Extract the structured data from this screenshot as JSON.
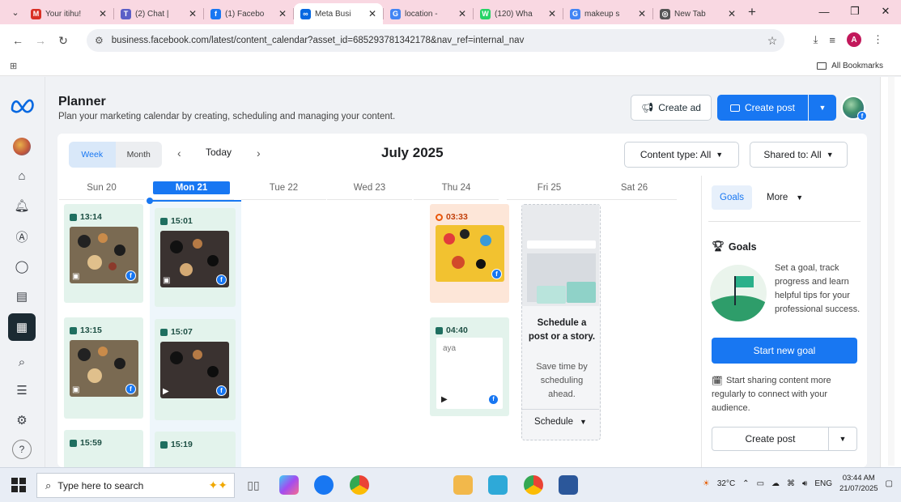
{
  "browser": {
    "tabs": [
      {
        "title": "Your itihu!",
        "icon": "gmail-icon",
        "color": "#d93025",
        "glyph": "M"
      },
      {
        "title": "(2) Chat |",
        "icon": "teams-icon",
        "color": "#5b5fc7",
        "glyph": "T"
      },
      {
        "title": "(1) Facebo",
        "icon": "facebook-icon",
        "color": "#1877f2",
        "glyph": "f"
      },
      {
        "title": "Meta Busi",
        "icon": "meta-icon",
        "color": "#0668e1",
        "glyph": "∞",
        "active": true
      },
      {
        "title": "location -",
        "icon": "google-icon",
        "color": "#4285f4",
        "glyph": "G"
      },
      {
        "title": "(120) Wha",
        "icon": "whatsapp-icon",
        "color": "#25d366",
        "glyph": "W"
      },
      {
        "title": "makeup s",
        "icon": "google-icon",
        "color": "#4285f4",
        "glyph": "G"
      },
      {
        "title": "New Tab",
        "icon": "chrome-icon",
        "color": "#555555",
        "glyph": "◎"
      }
    ],
    "url": "business.facebook.com/latest/content_calendar?asset_id=685293781342178&nav_ref=internal_nav",
    "profile_initial": "A",
    "all_bookmarks": "All Bookmarks"
  },
  "page": {
    "title": "Planner",
    "subtitle": "Plan your marketing calendar by creating, scheduling and managing your content.",
    "create_ad": "Create ad",
    "create_post": "Create post"
  },
  "calendar": {
    "view_week": "Week",
    "view_month": "Month",
    "today": "Today",
    "month_label": "July 2025",
    "content_type": "Content type: All",
    "shared_to": "Shared to: All",
    "days": [
      "Sun 20",
      "Mon 21",
      "Tue 22",
      "Wed 23",
      "Thu 24",
      "Fri 25",
      "Sat 26"
    ],
    "posts": {
      "sun": [
        "13:14",
        "13:15",
        "15:59"
      ],
      "mon": [
        "15:01",
        "15:07",
        "15:19"
      ],
      "thu": [
        "03:33",
        "04:40"
      ],
      "thu_text_preview": "aya"
    },
    "schedule_card": {
      "heading": "Schedule a post or a story.",
      "body": "Save time by scheduling ahead.",
      "button": "Schedule"
    }
  },
  "panel": {
    "tab_goals": "Goals",
    "tab_more": "More",
    "goals_heading": "Goals",
    "goals_text": "Set a goal, track progress and learn helpful tips for your professional success.",
    "start_goal": "Start new goal",
    "share_text": "Start sharing content more regularly to connect with your audience.",
    "create_post": "Create post"
  },
  "taskbar": {
    "search_placeholder": "Type here to search",
    "weather": "32°C",
    "lang": "ENG",
    "time": "03:44 AM",
    "date": "21/07/2025"
  },
  "colors": {
    "accent": "#1877f2",
    "tab_strip": "#f9d8e2"
  }
}
